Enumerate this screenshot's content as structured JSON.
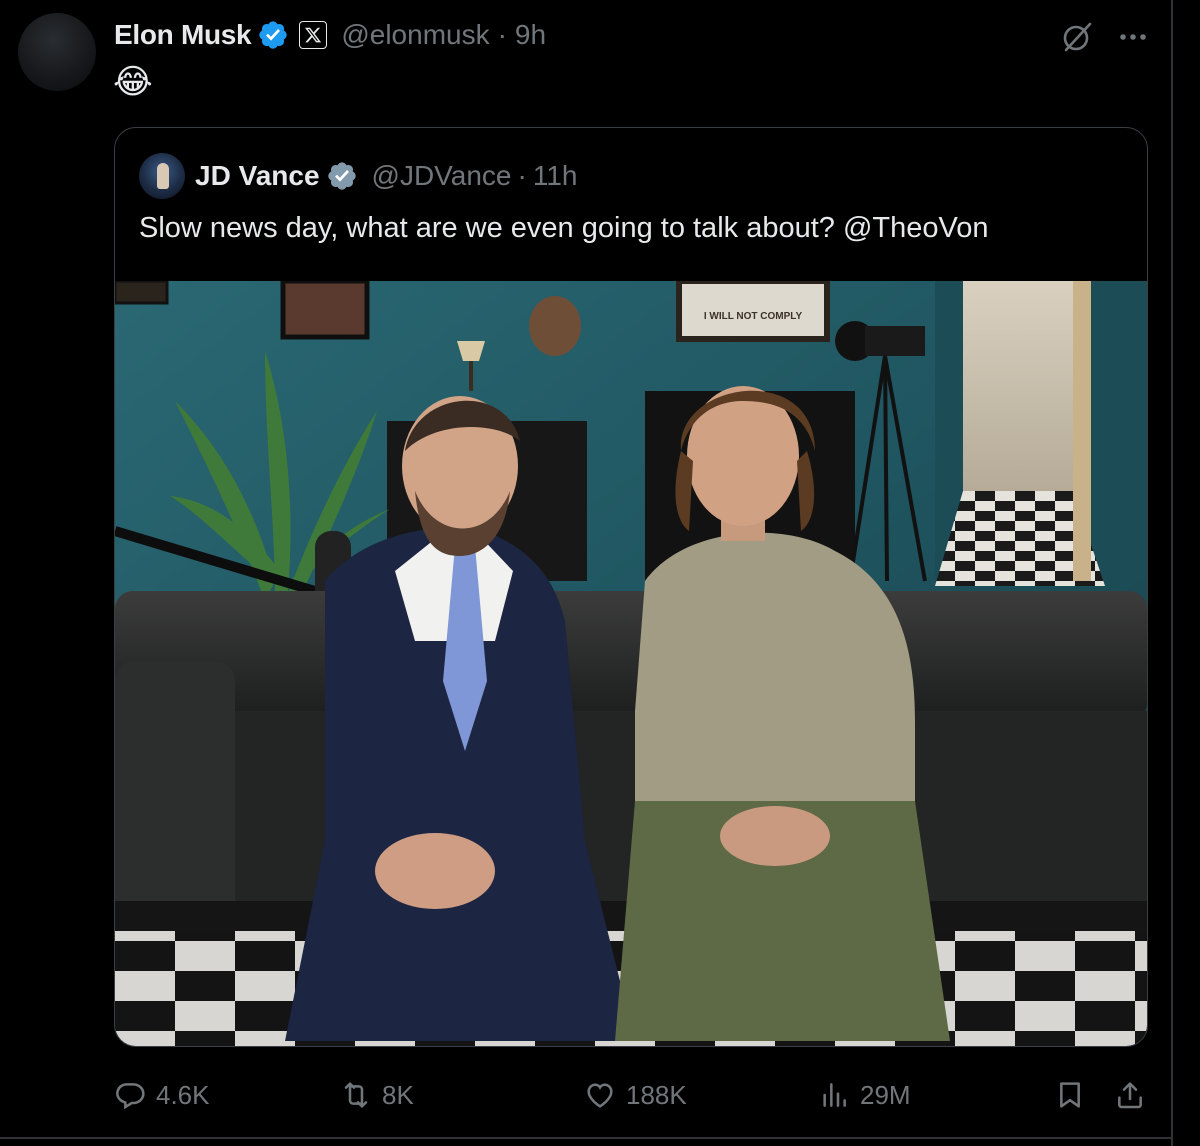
{
  "post": {
    "author_name": "Elon Musk",
    "handle": "@elonmusk",
    "separator": "·",
    "time": "9h",
    "text": "😂"
  },
  "quote": {
    "author_name": "JD Vance",
    "handle": "@JDVance",
    "separator": "·",
    "time": "11h",
    "text": "Slow news day, what are we even going to talk about? @TheoVon",
    "image_sign_text": "I WILL NOT COMPLY"
  },
  "engagement": {
    "replies": "4.6K",
    "reposts": "8K",
    "likes": "188K",
    "views": "29M"
  },
  "icons": {
    "verified": "verified-badge-icon",
    "affiliate": "x-logo-icon",
    "grok": "grok-icon",
    "more": "more-icon",
    "reply": "reply-icon",
    "repost": "repost-icon",
    "like": "like-icon",
    "views": "views-icon",
    "bookmark": "bookmark-icon",
    "share": "share-icon"
  },
  "colors": {
    "background": "#000000",
    "text_primary": "#e7e9ea",
    "text_secondary": "#71767b",
    "verified_blue": "#1d9bf0",
    "verified_gray": "#829aab",
    "border": "#2f3336"
  }
}
